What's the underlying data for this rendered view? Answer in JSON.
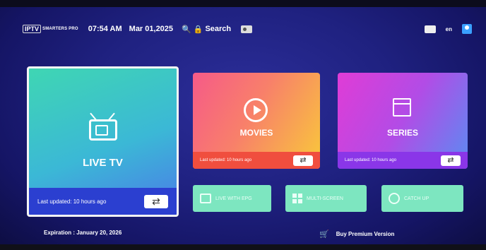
{
  "header": {
    "logo_main": "IPTV",
    "logo_sub": "SMARTERS PRO",
    "time": "07:54 AM",
    "date": "Mar 01,2025",
    "search_label": "Search",
    "language": "en"
  },
  "live_tv": {
    "title": "LIVE TV",
    "last_updated": "Last updated: 10 hours ago",
    "refresh": "⇄"
  },
  "movies": {
    "title": "MOVIES",
    "last_updated": "Last updated: 10 hours ago",
    "refresh": "⇄"
  },
  "series": {
    "title": "SERIES",
    "last_updated": "Last updated: 10 hours ago",
    "refresh": "⇄"
  },
  "buttons": {
    "epg": "LIVE WITH EPG",
    "multiscreen": "MULTI-SCREEN",
    "catchup": "CATCH UP"
  },
  "footer": {
    "expiration": "Expiration : January 20, 2026",
    "premium": "Buy Premium Version"
  }
}
